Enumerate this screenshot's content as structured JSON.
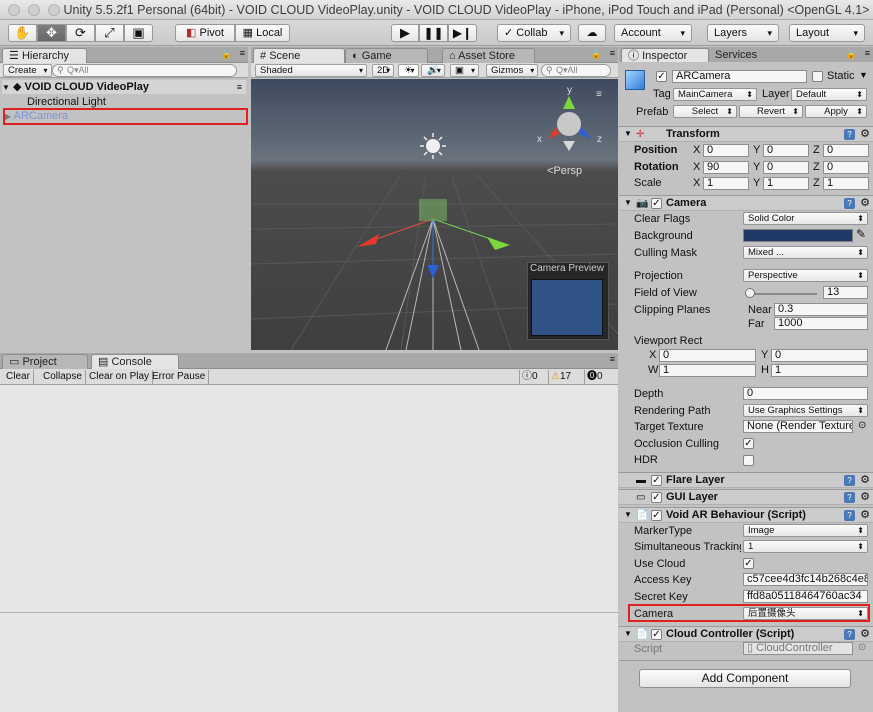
{
  "window": {
    "title": "Unity 5.5.2f1 Personal (64bit) - VOID CLOUD VideoPlay.unity - VOID CLOUD VideoPlay - iPhone, iPod Touch and iPad (Personal) <OpenGL 4.1>"
  },
  "toolbar": {
    "tools": [
      "hand-icon",
      "move-icon",
      "rotate-icon",
      "scale-icon",
      "rect-icon"
    ],
    "pivot": "Pivot",
    "local": "Local",
    "collab": "Collab",
    "account": "Account",
    "layers": "Layers",
    "layout": "Layout"
  },
  "hierarchy": {
    "tab": "Hierarchy",
    "create": "Create",
    "search_placeholder": "Q▾All",
    "scene": "VOID CLOUD VideoPlay",
    "items": [
      "Directional Light",
      "ARCamera"
    ]
  },
  "scene": {
    "tabs": [
      "Scene",
      "Game",
      "Asset Store"
    ],
    "shading": "Shaded",
    "mode2d": "2D",
    "gizmos": "Gizmos",
    "search_placeholder": "Q▾All",
    "persp": "Persp",
    "axis_y": "y",
    "axis_x": "x",
    "axis_z": "z",
    "camera_preview": "Camera Preview"
  },
  "console": {
    "tabs": [
      "Project",
      "Console"
    ],
    "buttons": [
      "Clear",
      "Collapse",
      "Clear on Play",
      "Error Pause"
    ],
    "counts": {
      "info": "0",
      "warn": "17",
      "error": "0"
    }
  },
  "inspector": {
    "tabs": [
      "Inspector",
      "Services"
    ],
    "object_name": "ARCamera",
    "static": "Static",
    "tag_label": "Tag",
    "tag_value": "MainCamera",
    "layer_label": "Layer",
    "layer_value": "Default",
    "prefab_label": "Prefab",
    "prefab_buttons": [
      "Select",
      "Revert",
      "Apply"
    ],
    "transform": {
      "name": "Transform",
      "position": {
        "label": "Position",
        "x": "0",
        "y": "0",
        "z": "0"
      },
      "rotation": {
        "label": "Rotation",
        "x": "90",
        "y": "0",
        "z": "0"
      },
      "scale": {
        "label": "Scale",
        "x": "1",
        "y": "1",
        "z": "1"
      },
      "axis_labels": [
        "X",
        "Y",
        "Z"
      ]
    },
    "camera": {
      "name": "Camera",
      "clear_flags": {
        "label": "Clear Flags",
        "value": "Solid Color"
      },
      "background": {
        "label": "Background",
        "color": "#1f3a67"
      },
      "culling_mask": {
        "label": "Culling Mask",
        "value": "Mixed ..."
      },
      "projection": {
        "label": "Projection",
        "value": "Perspective"
      },
      "fov": {
        "label": "Field of View",
        "value": "13"
      },
      "clipping": {
        "label": "Clipping Planes",
        "near_label": "Near",
        "near": "0.3",
        "far_label": "Far",
        "far": "1000"
      },
      "viewport": {
        "label": "Viewport Rect",
        "x": "0",
        "y": "0",
        "w": "1",
        "h": "1"
      },
      "depth": {
        "label": "Depth",
        "value": "0"
      },
      "rendering_path": {
        "label": "Rendering Path",
        "value": "Use Graphics Settings"
      },
      "target_texture": {
        "label": "Target Texture",
        "value": "None (Render Texture"
      },
      "occlusion": {
        "label": "Occlusion Culling"
      },
      "hdr": {
        "label": "HDR"
      }
    },
    "flare_layer": "Flare Layer",
    "gui_layer": "GUI Layer",
    "void_ar": {
      "name": "Void AR Behaviour (Script)",
      "marker_type": {
        "label": "MarkerType",
        "value": "Image"
      },
      "sim_tracking": {
        "label": "Simultaneous Tracking",
        "value": "1"
      },
      "use_cloud": {
        "label": "Use Cloud"
      },
      "access_key": {
        "label": "Access Key",
        "value": "c57cee4d3fc14b268c4e8"
      },
      "secret_key": {
        "label": "Secret Key",
        "value": "ffd8a05118464760ac34"
      },
      "camera": {
        "label": "Camera",
        "value": "后置摄像头"
      }
    },
    "cloud_controller": {
      "name": "Cloud Controller (Script)",
      "script_label": "Script",
      "script_value": "CloudController"
    },
    "add_component": "Add Component"
  },
  "colors": {
    "accent_red": "#e02020",
    "selection_text": "#7a95d8"
  }
}
